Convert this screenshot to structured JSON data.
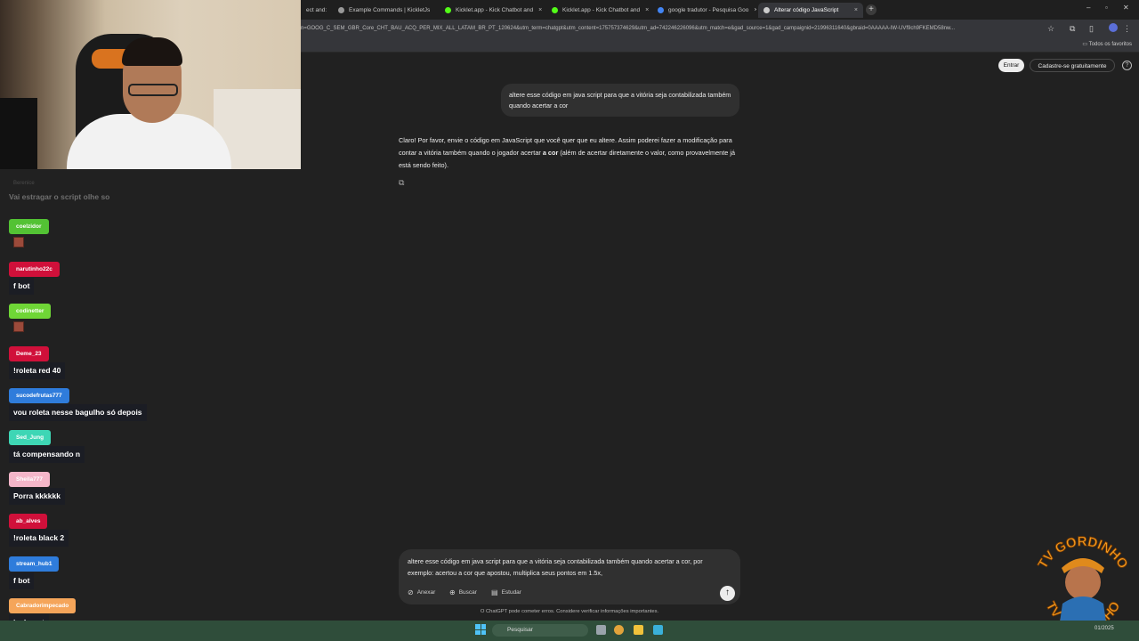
{
  "browser": {
    "tabs": [
      {
        "label": "ect and:",
        "color": "#6aa84f",
        "active": false
      },
      {
        "label": "Example Commands | KickletJs",
        "color": "#999999",
        "active": false
      },
      {
        "label": "Kicklet.app - Kick Chatbot and",
        "color": "#53fc18",
        "active": false
      },
      {
        "label": "Kicklet.app - Kick Chatbot and",
        "color": "#53fc18",
        "active": false
      },
      {
        "label": "google tradutor - Pesquisa Goo",
        "color": "#4285f4",
        "active": false
      },
      {
        "label": "Alterar código JavaScript",
        "color": "#cccccc",
        "active": true
      }
    ],
    "url": "n=GOOG_C_SEM_GBR_Core_CHT_BAU_ACQ_PER_MIX_ALL_LATAM_BR_PT_120624&utm_term=chatgpt&utm_content=175757374629&utm_ad=742246226096&utm_match=e&gad_source=1&gad_campaignid=21996311640&gbraid=0AAAAA-IW-UVf9ch9FKEMD58nw...",
    "bookmarks_label": "Todos os favoritos"
  },
  "header": {
    "login_label": "Entrar",
    "signup_label": "Cadastre-se gratuitamente",
    "help_glyph": "?"
  },
  "conversation": {
    "user_message": "altere esse código em java script para que a vitória seja contabilizada também quando acertar a cor",
    "assistant_before_bold": "Claro! Por favor, envie o código em JavaScript que você quer que eu altere. Assim poderei fazer a modificação para contar a vitória também quando o jogador acertar ",
    "assistant_bold": "a cor",
    "assistant_after_bold": " (além de acertar diretamente o valor, como provavelmente já está sendo feito)."
  },
  "composer": {
    "text": "altere esse código em java script para que a vitória seja contabilizada também quando acertar a cor, por exemplo: acertou a cor que apostou, multiplica seus pontos em 1.5x,",
    "attach_label": "Anexar",
    "search_label": "Buscar",
    "study_label": "Estudar",
    "disclaimer": "O ChatGPT pode cometer erros. Considere verificar informações importantes."
  },
  "stream_chat": {
    "ghost_username": "Berenice",
    "ghost_message": "Vai estragar o script olhe so",
    "messages": [
      {
        "user": "coelzidor",
        "color": "#53c234",
        "text": "",
        "emote": true
      },
      {
        "user": "narutinho22c",
        "color": "#d0103a",
        "text": "f bot",
        "emote": false
      },
      {
        "user": "codinetter",
        "color": "#6fd636",
        "text": "",
        "emote": true
      },
      {
        "user": "Deme_23",
        "color": "#d0103a",
        "text": "!roleta red 40",
        "emote": false
      },
      {
        "user": "sucodefrutas777",
        "color": "#2f7cdb",
        "text": "vou roleta nesse bagulho só depois",
        "emote": false
      },
      {
        "user": "Sed_Jung",
        "color": "#3ed6b5",
        "text": "tá compensando n",
        "emote": false
      },
      {
        "user": "Sheila777",
        "color": "#f4b6c9",
        "text": "Porra kkkkkk",
        "emote": false
      },
      {
        "user": "ab_alves",
        "color": "#d0103a",
        "text": "!roleta black 2",
        "emote": false
      },
      {
        "user": "stream_hub1",
        "color": "#2f7cdb",
        "text": "f bot",
        "emote": false
      },
      {
        "user": "Cabradorimpecado",
        "color": "#f5a55a",
        "text": "jackppot",
        "emote": false
      }
    ]
  },
  "overlay": {
    "logo_text": "TV GORDINHO"
  },
  "taskbar": {
    "search_placeholder": "Pesquisar",
    "clock": "01/2025"
  }
}
